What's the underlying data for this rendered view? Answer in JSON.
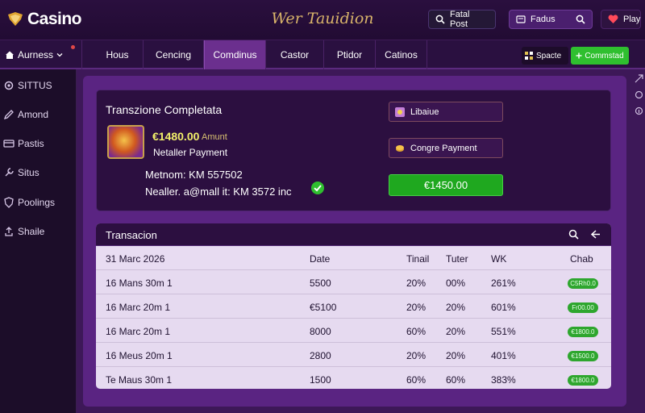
{
  "header": {
    "logo_text": "Casino",
    "site_title": "Wer Tauidion",
    "search_label": "Fatal Post",
    "search2_label": "Fadus",
    "play_label": "Play"
  },
  "nav": {
    "left_label": "Aurness",
    "tabs": [
      {
        "label": "Hous"
      },
      {
        "label": "Cencing"
      },
      {
        "label": "Comdinus"
      },
      {
        "label": "Castor"
      },
      {
        "label": "Ptidor"
      },
      {
        "label": "Catinos"
      }
    ],
    "space_label": "Spacte",
    "action_label": "Commstad"
  },
  "sidebar": {
    "items": [
      {
        "label": "SITTUS",
        "icon": "gear-icon"
      },
      {
        "label": "Amond",
        "icon": "pen-icon"
      },
      {
        "label": "Pastis",
        "icon": "card-icon"
      },
      {
        "label": "Situs",
        "icon": "wrench-icon"
      },
      {
        "label": "Poolings",
        "icon": "shield-icon"
      },
      {
        "label": "Shaile",
        "icon": "share-icon"
      }
    ]
  },
  "summary": {
    "title": "Transzione Completata",
    "amount": "€1480.00",
    "amount_label": "Amunt",
    "payment": "Netaller Payment",
    "method": "Metnom: KM 557502",
    "neteller_mail": "Nealler. a@mall it: KM 3572 inc",
    "btn_lib": "Libaiue",
    "btn_change": "Congre Payment",
    "btn_total": "€1450.00",
    "accent": "#2fbf2f"
  },
  "transactions": {
    "title": "Transacion",
    "header": {
      "date": "31 Marc 2026",
      "amount": "Date",
      "fee": "Tinail",
      "tax": "Tuter",
      "wk": "WK",
      "badge": "Chab"
    },
    "rows": [
      {
        "date": "16 Mans 30m 1",
        "amount": "5500",
        "fee": "20%",
        "tax": "00%",
        "wk": "261%",
        "badge": "C5Rh0.0"
      },
      {
        "date": "16 Marc 20m 1",
        "amount": "€5100",
        "fee": "20%",
        "tax": "20%",
        "wk": "601%",
        "badge": "Fr00.00"
      },
      {
        "date": "16 Marc 20m 1",
        "amount": "8000",
        "fee": "60%",
        "tax": "20%",
        "wk": "551%",
        "badge": "€1800.0"
      },
      {
        "date": "16 Meus 20m 1",
        "amount": "2800",
        "fee": "20%",
        "tax": "20%",
        "wk": "401%",
        "badge": "€1500.0"
      },
      {
        "date": "Te Maus 30m 1",
        "amount": "1500",
        "fee": "60%",
        "tax": "60%",
        "wk": "383%",
        "badge": "€1800.0"
      }
    ]
  }
}
